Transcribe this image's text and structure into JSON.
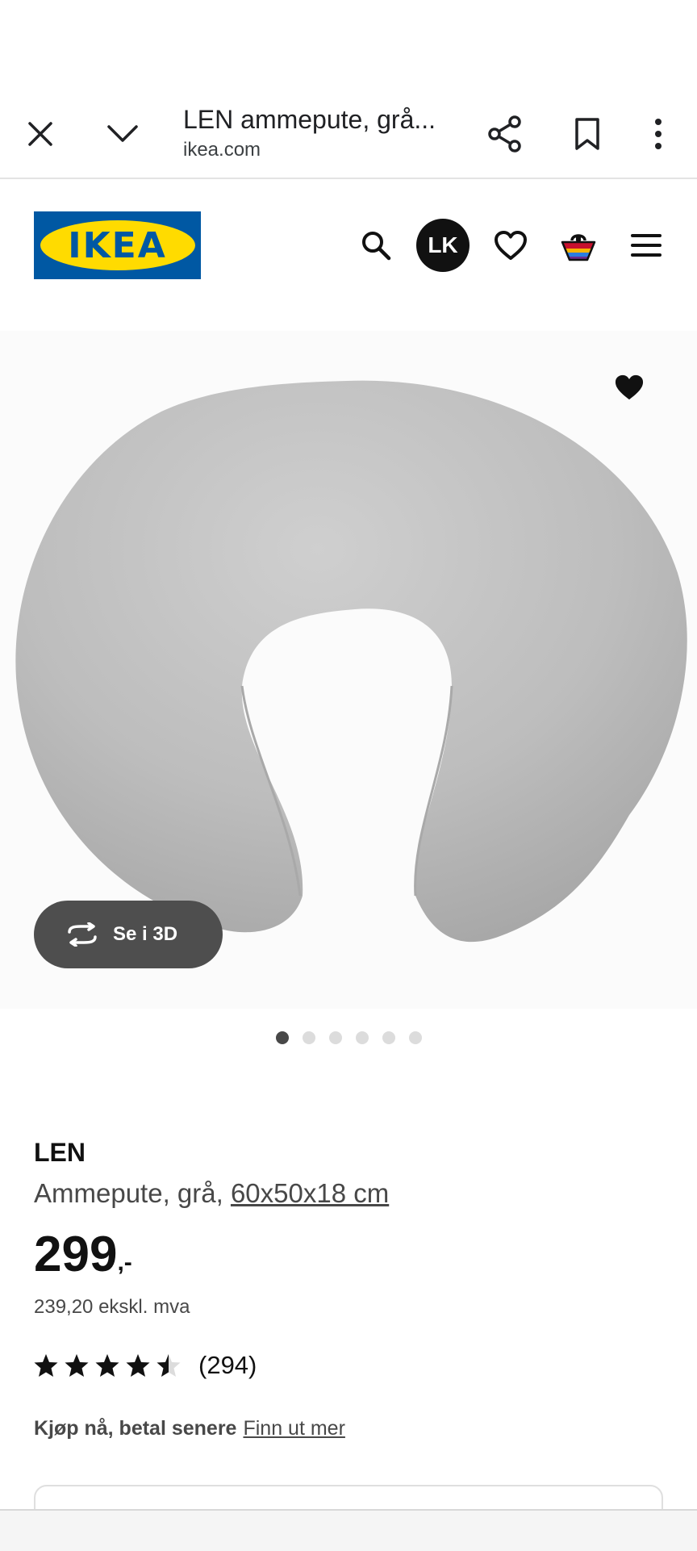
{
  "browser": {
    "title": "LEN ammepute, grå...",
    "url": "ikea.com"
  },
  "header": {
    "logo_text": "IKEA",
    "avatar_initials": "LK",
    "brand_blue": "#0058a3",
    "brand_yellow": "#ffdb00"
  },
  "gallery": {
    "view_3d_label": "Se i 3D",
    "image_count": 6,
    "active_index": 0
  },
  "product": {
    "name": "LEN",
    "description_prefix": "Ammepute, grå, ",
    "size": "60x50x18 cm",
    "price_integer": "299",
    "price_suffix": ",-",
    "price_ex_vat": "239,20 ekskl. mva",
    "rating_value": 4.5,
    "rating_max": 5,
    "review_count": "(294)"
  },
  "financing": {
    "text": "Kjøp nå, betal senere",
    "link": "Finn ut mer"
  }
}
